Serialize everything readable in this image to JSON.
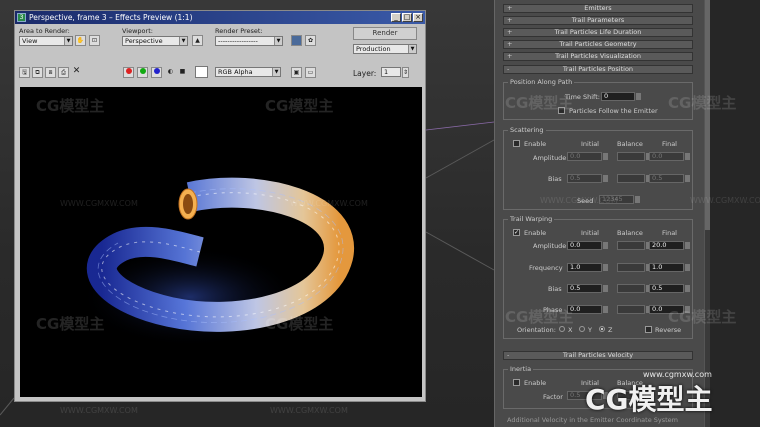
{
  "window": {
    "title": "Perspective, frame 3 – Effects Preview (1:1)",
    "minimize": "_",
    "maximize": "□",
    "close": "×"
  },
  "toolbar": {
    "area_label": "Area to Render:",
    "area_value": "View",
    "viewport_label": "Viewport:",
    "viewport_value": "Perspective",
    "preset_label": "Render Preset:",
    "preset_value": "-----------------",
    "render_button": "Render",
    "production_value": "Production",
    "channel_value": "RGB Alpha",
    "layer_label": "Layer:",
    "layer_value": "1"
  },
  "watermarks": {
    "logo": "CG模型主",
    "url": "WWW.CGMXW.COM",
    "url_bottom": "www.cgmxw.com"
  },
  "panel": {
    "rollouts": [
      {
        "sign": "+",
        "label": "Emitters"
      },
      {
        "sign": "+",
        "label": "Trail Parameters"
      },
      {
        "sign": "+",
        "label": "Trail Particles Life Duration"
      },
      {
        "sign": "+",
        "label": "Trail Particles Geometry"
      },
      {
        "sign": "+",
        "label": "Trail Particles Visualization"
      },
      {
        "sign": "-",
        "label": "Trail Particles Position"
      }
    ],
    "position_group": {
      "title": "Position Along Path",
      "time_shift_label": "Time Shift:",
      "time_shift_value": "0",
      "follow_label": "Particles Follow the Emitter"
    },
    "scattering": {
      "title": "Scattering",
      "enable_label": "Enable",
      "col_initial": "Initial",
      "col_balance": "Balance",
      "col_final": "Final",
      "amplitude_label": "Amplitude",
      "amplitude_initial": "0.0",
      "amplitude_final": "0.0",
      "bias_label": "Bias",
      "bias_initial": "0.5",
      "bias_final": "0.5",
      "seed_label": "Seed",
      "seed_value": "12345"
    },
    "warping": {
      "title": "Trail Warping",
      "enable_label": "Enable",
      "col_initial": "Initial",
      "col_balance": "Balance",
      "col_final": "Final",
      "amplitude_label": "Amplitude",
      "amplitude_initial": "0.0",
      "amplitude_final": "20.0",
      "frequency_label": "Frequency",
      "frequency_initial": "1.0",
      "frequency_final": "1.0",
      "bias_label": "Bias",
      "bias_initial": "0.5",
      "bias_final": "0.5",
      "phase_label": "Phase",
      "phase_initial": "0.0",
      "phase_final": "0.0",
      "orientation_label": "Orientation:",
      "x_label": "X",
      "y_label": "Y",
      "z_label": "Z",
      "reverse_label": "Reverse"
    },
    "velocity_rollout": {
      "sign": "-",
      "label": "Trail Particles Velocity"
    },
    "inertia": {
      "title": "Inertia",
      "enable_label": "Enable",
      "col_initial": "Initial",
      "col_balance": "Balance",
      "factor_label": "Factor",
      "factor_initial": "0.5"
    },
    "additional_label": "Additional Velocity in the Emitter Coordinate System"
  }
}
